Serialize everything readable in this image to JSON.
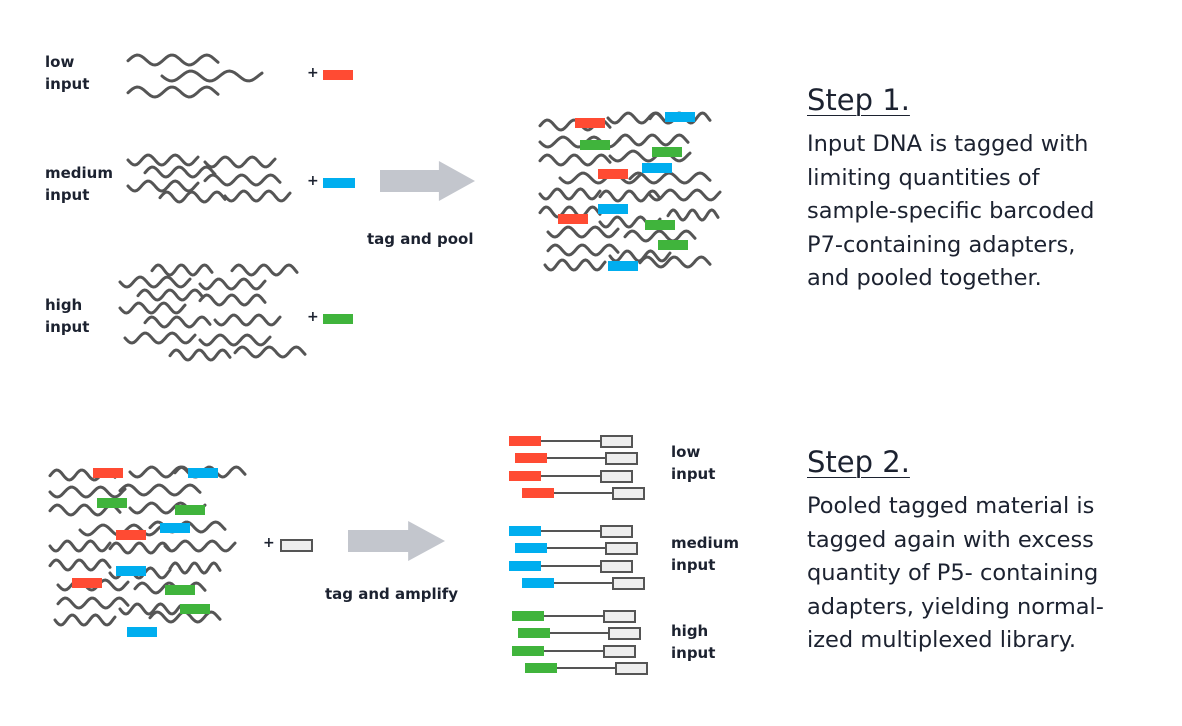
{
  "colors": {
    "red": "#ff4b33",
    "blue": "#00aeef",
    "green": "#40b43c",
    "strand": "#555555",
    "arrow": "#c3c6cd",
    "adapter_fill": "#eeeeee",
    "adapter_border": "#555555"
  },
  "step1": {
    "labels": {
      "low": [
        "low",
        "input"
      ],
      "medium": [
        "medium",
        "input"
      ],
      "high": [
        "high",
        "input"
      ]
    },
    "plus": "+",
    "arrow_label": "tag and pool",
    "heading": "Step 1.",
    "text": [
      "Input DNA is tagged with",
      "limiting quantities of",
      "sample-specific barcoded",
      "P7-containing adapters,",
      "and pooled together."
    ]
  },
  "step2": {
    "plus": "+",
    "arrow_label": "tag and amplify",
    "labels": {
      "low": [
        "low",
        "input"
      ],
      "medium": [
        "medium",
        "input"
      ],
      "high": [
        "high",
        "input"
      ]
    },
    "heading": "Step 2.",
    "text": [
      "Pooled tagged material is",
      "tagged again with excess",
      "quantity of P5- containing",
      "adapters, yielding normal-",
      "ized multiplexed library."
    ]
  }
}
